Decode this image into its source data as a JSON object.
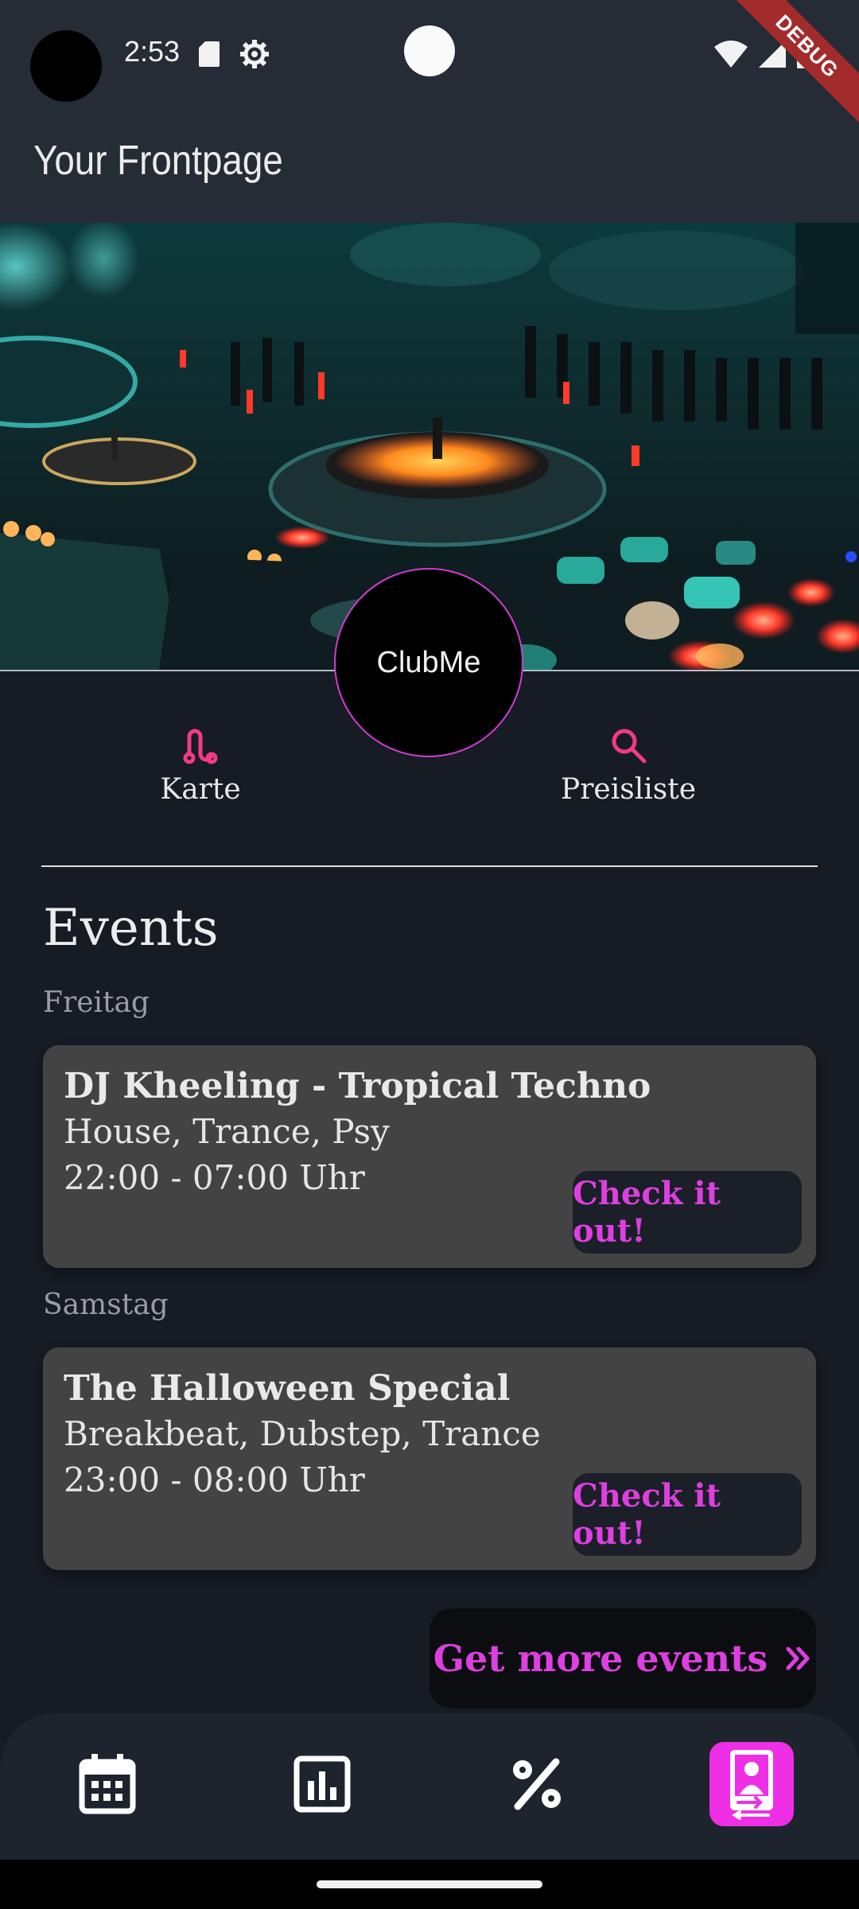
{
  "status_bar": {
    "time": "2:53",
    "icons": [
      "sd-card-icon",
      "gear-icon",
      "wifi-icon",
      "signal-icon",
      "battery-icon"
    ]
  },
  "debug_banner": "DEBUG",
  "app_bar": {
    "title": "Your Frontpage"
  },
  "hero": {
    "image": "dj-mixer-photo",
    "club_name": "ClubMe"
  },
  "quick_actions": [
    {
      "label": "Karte",
      "icon": "route-icon"
    },
    {
      "label": "Preisliste",
      "icon": "search-icon"
    }
  ],
  "events_section": {
    "title": "Events",
    "groups": [
      {
        "day": "Freitag",
        "event": {
          "title": "DJ Kheeling - Tropical Techno",
          "genres": "House, Trance, Psy",
          "time": "22:00 - 07:00 Uhr",
          "button": "Check it out!"
        }
      },
      {
        "day": "Samstag",
        "event": {
          "title": "The Halloween Special",
          "genres": "Breakbeat, Dubstep, Trance",
          "time": "23:00 - 08:00 Uhr",
          "button": "Check it out!"
        }
      }
    ],
    "more_button": "Get more events"
  },
  "bottom_nav": {
    "items": [
      {
        "icon": "calendar-icon",
        "active": false
      },
      {
        "icon": "bar-chart-icon",
        "active": false
      },
      {
        "icon": "percent-icon",
        "active": false
      },
      {
        "icon": "club-frontpage-icon",
        "active": true
      }
    ]
  },
  "colors": {
    "accent": "#dd3fe0",
    "accent_active_bg": "#ee2fe6",
    "icon_pink": "#f23a86",
    "background": "#161b24",
    "card": "#434343",
    "app_bar": "#262c35"
  }
}
